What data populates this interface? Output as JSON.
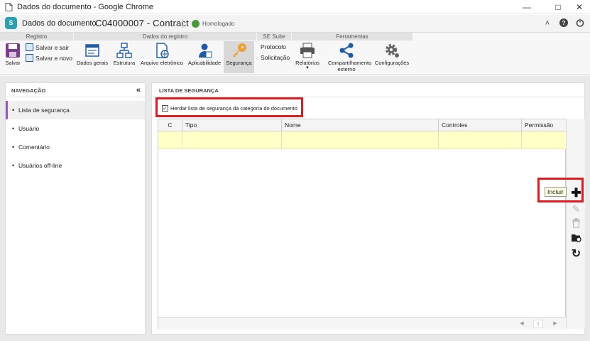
{
  "window": {
    "title": "Dados do documento - Google Chrome"
  },
  "header": {
    "app_name": "Dados do documento",
    "doc_title": "C04000007 - Contract",
    "status": "Homologado"
  },
  "ribbon": {
    "groups": [
      "Registro",
      "Dados do registro",
      "SE Suite",
      "Ferramentas"
    ],
    "registro": {
      "save": "Salvar",
      "save_exit": "Salvar e sair",
      "save_new": "Salvar e novo"
    },
    "dados": [
      "Dados gerais",
      "Estrutura",
      "Arquivo eletrônico",
      "Aplicabilidade",
      "Segurança"
    ],
    "suite": [
      "Protocolo",
      "Solicitação"
    ],
    "tools": [
      "Relatórios",
      "Compartilhamento externo",
      "Configurações"
    ]
  },
  "nav": {
    "title": "NAVEGAÇÃO",
    "items": [
      "Lista de segurança",
      "Usuário",
      "Comentário",
      "Usuários off-line"
    ]
  },
  "main": {
    "title": "LISTA DE SEGURANÇA",
    "inherit_label": "Herdar lista de segurança da categoria do documento",
    "columns": [
      "C",
      "Tipo",
      "Nome",
      "Controles",
      "Permissão"
    ],
    "page": "1",
    "tooltip": "Incluir"
  },
  "colors": {
    "accent": "#9b59b6",
    "highlight": "#e01b22",
    "selected_row": "#ffffc8"
  }
}
